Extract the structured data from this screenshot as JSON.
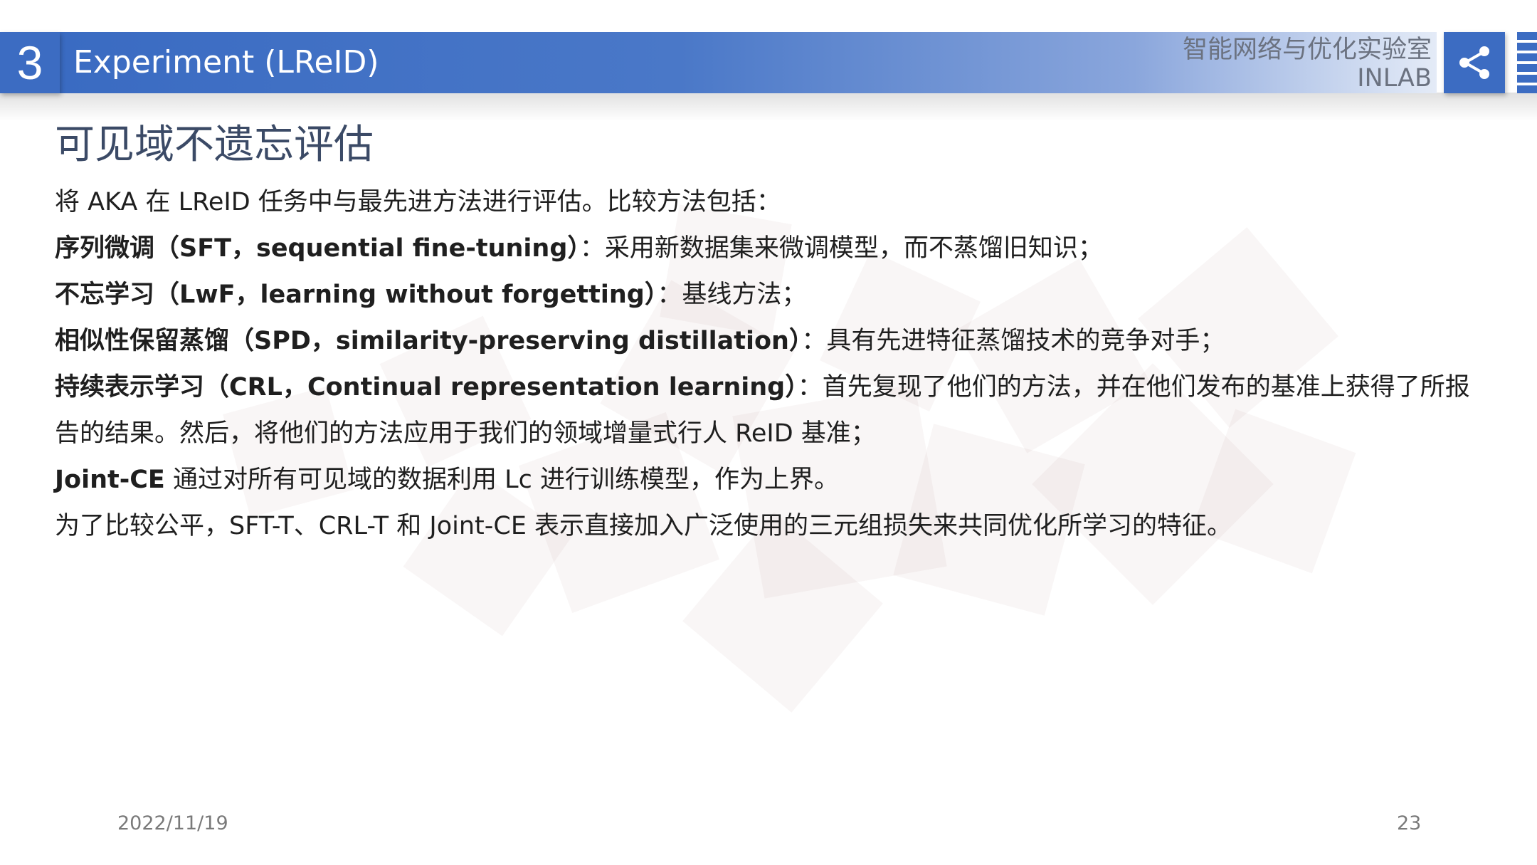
{
  "header": {
    "section_number": "3",
    "title": "Experiment (LReID)",
    "lab_name_cn": "智能网络与优化实验室",
    "lab_name_en": "INLAB",
    "share_icon": "share-icon"
  },
  "slide": {
    "subtitle": "可见域不遗忘评估",
    "intro": "将 AKA 在 LReID 任务中与最先进方法进行评估。比较方法包括：",
    "methods": [
      {
        "term": "序列微调（SFT，sequential fine-tuning）",
        "desc": "：采用新数据集来微调模型，而不蒸馏旧知识；"
      },
      {
        "term": "不忘学习（LwF，learning without forgetting）",
        "desc": "：基线方法；"
      },
      {
        "term": "相似性保留蒸馏（SPD，similarity-preserving distillation）",
        "desc": "：具有先进特征蒸馏技术的竞争对手；"
      },
      {
        "term": "持续表示学习（CRL，Continual representation learning）",
        "desc": "：首先复现了他们的方法，并在他们发布的基准上获得了所报告的结果。然后，将他们的方法应用于我们的领域增量式行人 ReID 基准；"
      },
      {
        "term": "Joint-CE",
        "desc": " 通过对所有可见域的数据利用 Lc 进行训练模型，作为上界。"
      }
    ],
    "closing": "为了比较公平，SFT-T、CRL-T 和 Joint-CE 表示直接加入广泛使用的三元组损失来共同优化所学习的特征。"
  },
  "footer": {
    "date": "2022/11/19",
    "page": "23"
  },
  "colors": {
    "accent": "#3c6cc2",
    "subtitle": "#3b4a66",
    "watermark": "#c9a9ad"
  }
}
